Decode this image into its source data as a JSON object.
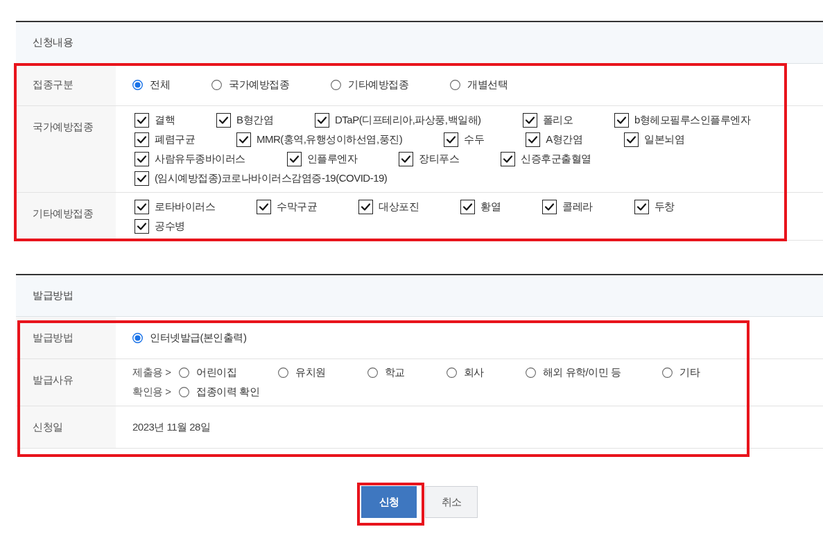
{
  "sections": [
    {
      "title": "신청내용",
      "highlighted": true,
      "rows": [
        {
          "label": "접종구분",
          "kind": "radios",
          "options": [
            {
              "label": "전체",
              "selected": true
            },
            {
              "label": "국가예방접종",
              "selected": false
            },
            {
              "label": "기타예방접종",
              "selected": false
            },
            {
              "label": "개별선택",
              "selected": false
            }
          ]
        },
        {
          "label": "국가예방접종",
          "kind": "checkboxes",
          "lines": [
            {
              "options": [
                {
                  "label": "결핵",
                  "checked": true
                },
                {
                  "label": "B형간염",
                  "checked": true
                },
                {
                  "label": "DTaP(디프테리아,파상풍,백일해)",
                  "checked": true
                },
                {
                  "label": "폴리오",
                  "checked": true
                },
                {
                  "label": "b형헤모필루스인플루엔자",
                  "checked": true
                }
              ]
            },
            {
              "options": [
                {
                  "label": "폐렴구균",
                  "checked": true
                },
                {
                  "label": "MMR(홍역,유행성이하선염,풍진)",
                  "checked": true
                },
                {
                  "label": "수두",
                  "checked": true
                },
                {
                  "label": "A형간염",
                  "checked": true
                },
                {
                  "label": "일본뇌염",
                  "checked": true
                }
              ]
            },
            {
              "options": [
                {
                  "label": "사람유두종바이러스",
                  "checked": true
                },
                {
                  "label": "인플루엔자",
                  "checked": true
                },
                {
                  "label": "장티푸스",
                  "checked": true
                },
                {
                  "label": "신증후군출혈열",
                  "checked": true
                }
              ]
            },
            {
              "options": [
                {
                  "label": "(임시예방접종)코로나바이러스감염증-19(COVID-19)",
                  "checked": true
                }
              ]
            }
          ]
        },
        {
          "label": "기타예방접종",
          "kind": "checkboxes",
          "lines": [
            {
              "options": [
                {
                  "label": "로타바이러스",
                  "checked": true
                },
                {
                  "label": "수막구균",
                  "checked": true
                },
                {
                  "label": "대상포진",
                  "checked": true
                },
                {
                  "label": "황열",
                  "checked": true
                },
                {
                  "label": "콜레라",
                  "checked": true
                },
                {
                  "label": "두창",
                  "checked": true
                }
              ]
            },
            {
              "options": [
                {
                  "label": "공수병",
                  "checked": true
                }
              ]
            }
          ]
        }
      ]
    },
    {
      "title": "발급방법",
      "highlighted": true,
      "rows": [
        {
          "label": "발급방법",
          "kind": "radios",
          "options": [
            {
              "label": "인터넷발급(본인출력)",
              "selected": true
            }
          ]
        },
        {
          "label": "발급사유",
          "kind": "radio_groups",
          "groups": [
            {
              "prefix": "제출용 >",
              "options": [
                {
                  "label": "어린이집",
                  "selected": false
                },
                {
                  "label": "유치원",
                  "selected": false
                },
                {
                  "label": "학교",
                  "selected": false
                },
                {
                  "label": "회사",
                  "selected": false
                },
                {
                  "label": "해외 유학/이민 등",
                  "selected": false
                },
                {
                  "label": "기타",
                  "selected": false
                }
              ]
            },
            {
              "prefix": "확인용 >",
              "options": [
                {
                  "label": "접종이력 확인",
                  "selected": false
                }
              ]
            }
          ]
        },
        {
          "label": "신청일",
          "kind": "text",
          "value": "2023년 11월 28일"
        }
      ]
    }
  ],
  "buttons": [
    {
      "label": "신청",
      "kind": "primary",
      "highlighted": true
    },
    {
      "label": "취소",
      "kind": "secondary"
    }
  ]
}
